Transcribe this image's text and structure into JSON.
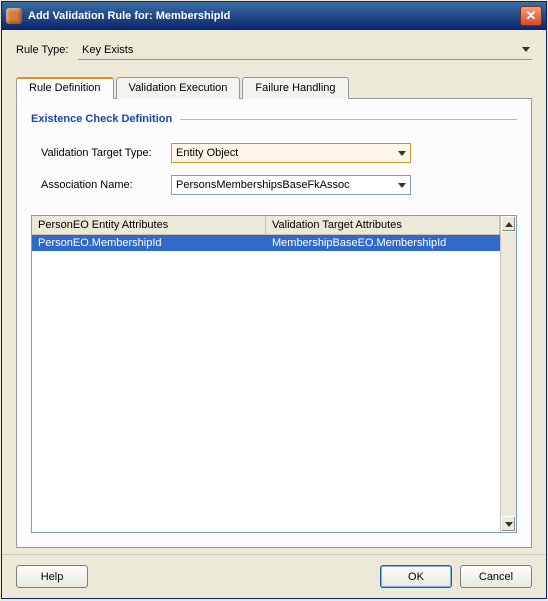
{
  "titlebar": {
    "title": "Add Validation Rule for: MembershipId"
  },
  "ruleType": {
    "label": "Rule Type:",
    "value": "Key Exists"
  },
  "tabs": [
    {
      "label": "Rule Definition",
      "active": true
    },
    {
      "label": "Validation Execution",
      "active": false
    },
    {
      "label": "Failure Handling",
      "active": false
    }
  ],
  "group": {
    "title": "Existence Check Definition"
  },
  "targetType": {
    "label": "Validation Target Type:",
    "value": "Entity Object"
  },
  "assocName": {
    "label": "Association Name:",
    "value": "PersonsMembershipsBaseFkAssoc"
  },
  "table": {
    "headers": [
      "PersonEO Entity Attributes",
      "Validation Target Attributes"
    ],
    "rows": [
      {
        "c1": "PersonEO.MembershipId",
        "c2": "MembershipBaseEO.MembershipId",
        "selected": true
      }
    ]
  },
  "buttons": {
    "help": "Help",
    "ok": "OK",
    "cancel": "Cancel"
  }
}
